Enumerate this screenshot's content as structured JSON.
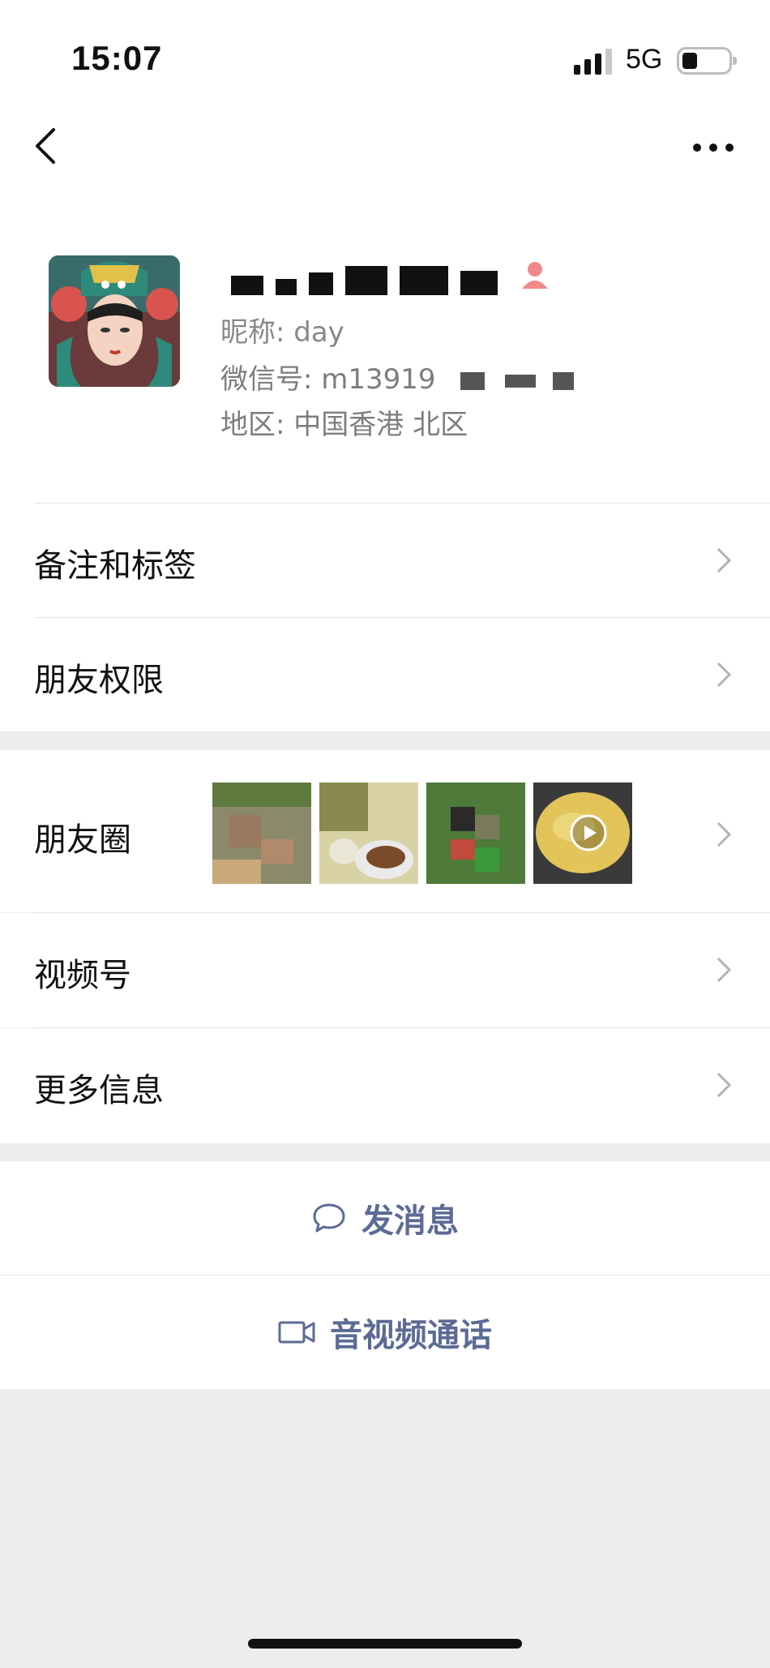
{
  "status_bar": {
    "time": "15:07",
    "network": "5G"
  },
  "profile": {
    "nickname_label": "昵称: day",
    "wechat_id": "微信号: m13919",
    "region": "地区: 中国香港 北区"
  },
  "menu": {
    "remark_tags": "备注和标签",
    "friend_permissions": "朋友权限",
    "moments": "朋友圈",
    "channels": "视频号",
    "more_info": "更多信息"
  },
  "actions": {
    "send_message": "发消息",
    "av_call": "音视频通话"
  },
  "colors": {
    "accent": "#5b6b95",
    "background": "#ededed",
    "gender": "#f08a8a"
  },
  "icons": [
    "back-icon",
    "more-icon",
    "gender-female-icon",
    "chevron-right-icon",
    "message-bubble-icon",
    "video-call-icon",
    "play-icon"
  ]
}
